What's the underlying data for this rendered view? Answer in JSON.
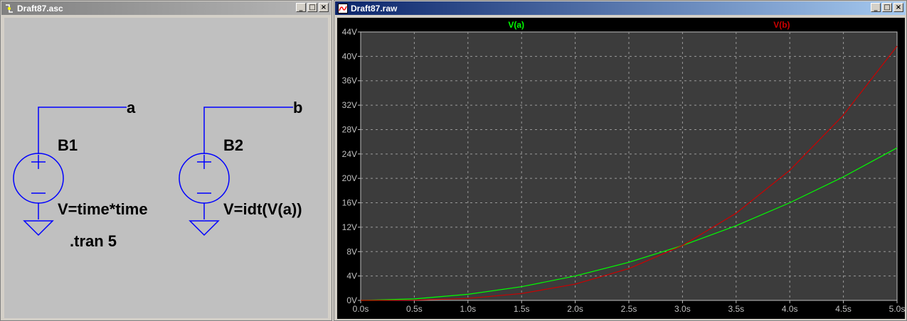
{
  "schematic": {
    "title": "Draft87.asc",
    "net_a": "a",
    "net_b": "b",
    "b1_name": "B1",
    "b1_value": "V=time*time",
    "b2_name": "B2",
    "b2_value": "V=idt(V(a))",
    "directive": ".tran 5",
    "wire_color": "#0000ff"
  },
  "waveform": {
    "title": "Draft87.raw"
  },
  "window_buttons": {
    "minimize": "_",
    "maximize": "□",
    "close": "×"
  },
  "chart_data": {
    "type": "line",
    "title": "",
    "xlabel": "",
    "ylabel": "",
    "xlim": [
      0,
      5
    ],
    "ylim": [
      0,
      44
    ],
    "grid": true,
    "background": "#3c3c3c",
    "x_ticks": [
      "0.0s",
      "0.5s",
      "1.0s",
      "1.5s",
      "2.0s",
      "2.5s",
      "3.0s",
      "3.5s",
      "4.0s",
      "4.5s",
      "5.0s"
    ],
    "y_ticks": [
      "0V",
      "4V",
      "8V",
      "12V",
      "16V",
      "20V",
      "24V",
      "28V",
      "32V",
      "36V",
      "40V",
      "44V"
    ],
    "series": [
      {
        "name": "V(a)",
        "color": "#00ff00",
        "x": [
          0,
          0.5,
          1.0,
          1.5,
          2.0,
          2.5,
          3.0,
          3.5,
          4.0,
          4.5,
          5.0
        ],
        "values": [
          0,
          0.25,
          1.0,
          2.25,
          4.0,
          6.25,
          9.0,
          12.25,
          16.0,
          20.25,
          25.0
        ]
      },
      {
        "name": "V(b)",
        "color": "#cc0000",
        "x": [
          0,
          0.5,
          1.0,
          1.5,
          2.0,
          2.5,
          3.0,
          3.5,
          4.0,
          4.5,
          5.0
        ],
        "values": [
          0,
          0.04,
          0.33,
          1.13,
          2.67,
          5.21,
          9.0,
          14.29,
          21.33,
          30.38,
          41.67
        ]
      }
    ]
  }
}
